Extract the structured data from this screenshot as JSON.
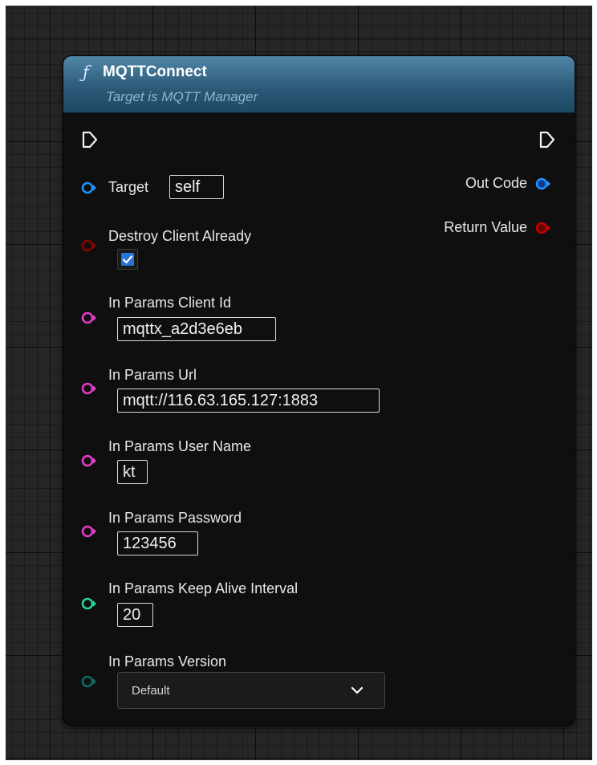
{
  "node": {
    "title": "MQTTConnect",
    "subtitle": "Target is MQTT Manager",
    "function_icon": "function-icon",
    "header_color": "#2b5876"
  },
  "outputs": {
    "out_code": "Out Code",
    "return_value": "Return Value"
  },
  "inputs": {
    "target": {
      "label": "Target",
      "value": "self"
    },
    "destroy_client_already": {
      "label": "Destroy Client Already",
      "checked": true
    },
    "client_id": {
      "label": "In Params Client Id",
      "value": "mqttx_a2d3e6eb"
    },
    "url": {
      "label": "In Params Url",
      "value": "mqtt://116.63.165.127:1883"
    },
    "user_name": {
      "label": "In Params User Name",
      "value": "kt"
    },
    "password": {
      "label": "In Params Password",
      "value": "123456"
    },
    "keep_alive_interval": {
      "label": "In Params Keep Alive Interval",
      "value": "20"
    },
    "version": {
      "label": "In Params Version",
      "value": "Default"
    }
  },
  "pin_colors": {
    "object": "#1e90ff",
    "bool": "#8b0000",
    "string": "#e63ac8",
    "int": "#27d39a",
    "enum": "#0b6b6b",
    "return": "#c00000"
  }
}
